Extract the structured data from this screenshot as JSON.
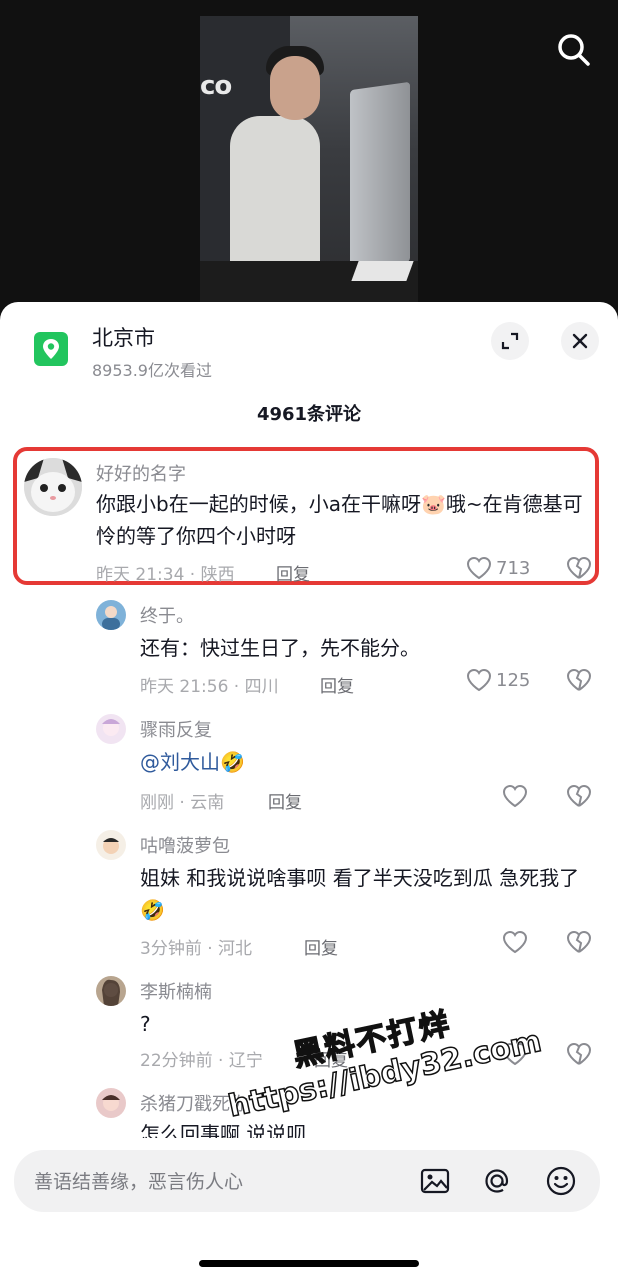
{
  "location": {
    "title": "北京市",
    "views": "8953.9亿次看过"
  },
  "comment_count": "4961条评论",
  "comments": [
    {
      "name": "好好的名字",
      "text": "你跟小b在一起的时候，小a在干嘛呀🐷哦~在肯德基可怜的等了你四个小时呀",
      "meta": "昨天 21:34 · 陕西",
      "reply": "回复",
      "likes": "713",
      "avatar": "cat-avatar",
      "highlighted": true
    },
    {
      "name": "终于。",
      "text": "还有：快过生日了，先不能分。",
      "meta": "昨天 21:56 · 四川",
      "reply": "回复",
      "likes": "125"
    },
    {
      "name": "骤雨反复",
      "text_mention": "@刘大山",
      "text_emoji": "🤣",
      "meta": "刚刚 · 云南",
      "reply": "回复",
      "likes": ""
    },
    {
      "name": "咕噜菠萝包",
      "text": "姐妹 和我说说啥事呗 看了半天没吃到瓜 急死我了🤣",
      "meta": "3分钟前 · 河北",
      "reply": "回复",
      "likes": ""
    },
    {
      "name": "李斯楠楠",
      "text": "?",
      "meta": "22分钟前 · 辽宁",
      "reply": "回复",
      "likes": ""
    },
    {
      "name": "杀猪刀戳死你",
      "text": "怎么回事啊 说说呗",
      "meta": "",
      "reply": "",
      "likes": ""
    }
  ],
  "watermark": {
    "line1": "黑料不打烊",
    "line2": "https://ibdy32.com"
  },
  "input": {
    "placeholder": "善语结善缘，恶言伤人心"
  },
  "colors": {
    "highlight": "#e53935",
    "location_icon": "#22c55e",
    "mention": "#2f5a9c"
  }
}
